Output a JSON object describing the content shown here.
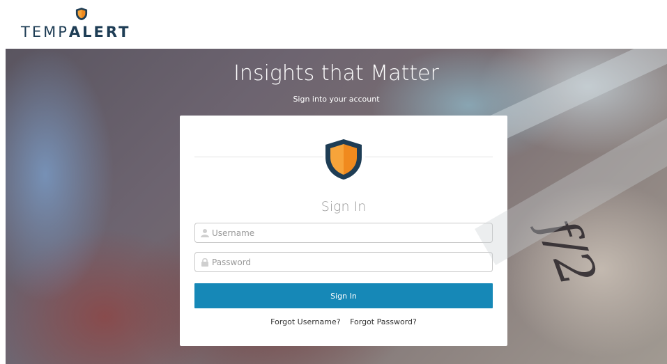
{
  "brand": {
    "logo_text_light": "TEMP",
    "logo_text_bold": "ALERT",
    "logo_icon": "shield-icon",
    "shield_colors": {
      "outer": "#1e3d55",
      "left": "#f7a43a",
      "right": "#f08a1e"
    }
  },
  "hero": {
    "title": "Insights that Matter",
    "subtitle": "Sign into your account",
    "scribble": "f/2"
  },
  "form": {
    "title": "Sign In",
    "username_placeholder": "Username",
    "password_placeholder": "Password",
    "username_icon": "user-icon",
    "password_icon": "lock-icon",
    "submit_label": "Sign In",
    "button_color": "#1688b7"
  },
  "links": {
    "forgot_username": "Forgot Username?",
    "forgot_password": "Forgot Password?"
  }
}
